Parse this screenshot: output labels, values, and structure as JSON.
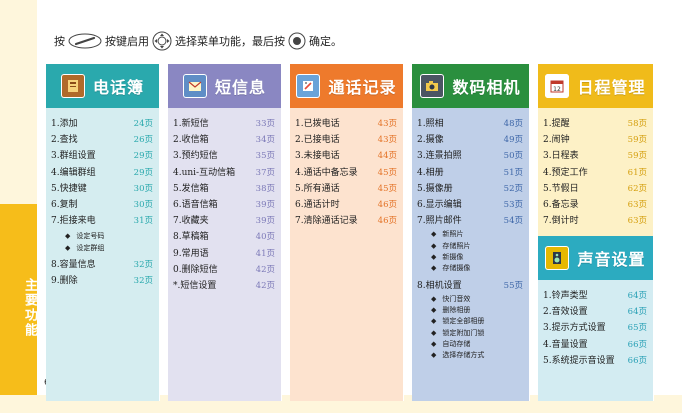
{
  "page": {
    "number": "6",
    "side_label": "主要功能"
  },
  "instruction": {
    "part1": "按",
    "part2": "按键启用",
    "part3": "选择菜单功能，最后按",
    "part4": "确定。"
  },
  "columns": [
    {
      "title": "电话簿",
      "icon": "phonebook-icon",
      "items": [
        {
          "label": "1.添加",
          "page": "24页"
        },
        {
          "label": "2.查找",
          "page": "26页"
        },
        {
          "label": "3.群组设置",
          "page": "29页"
        },
        {
          "label": "4.编辑群组",
          "page": "29页"
        },
        {
          "label": "5.快捷键",
          "page": "30页"
        },
        {
          "label": "6.复制",
          "page": "30页"
        },
        {
          "label": "7.拒接来电",
          "page": "31页",
          "subs": [
            "设定号码",
            "设定群组"
          ]
        },
        {
          "label": "8.容量信息",
          "page": "32页"
        },
        {
          "label": "9.删除",
          "page": "32页"
        }
      ]
    },
    {
      "title": "短信息",
      "icon": "envelope-icon",
      "items": [
        {
          "label": "1.新短信",
          "page": "33页"
        },
        {
          "label": "2.收信箱",
          "page": "34页"
        },
        {
          "label": "3.预约短信",
          "page": "35页"
        },
        {
          "label": "4.uni-互动信箱",
          "page": "37页"
        },
        {
          "label": "5.发信箱",
          "page": "38页"
        },
        {
          "label": "6.语音信箱",
          "page": "39页"
        },
        {
          "label": "7.收藏夹",
          "page": "39页"
        },
        {
          "label": "8.草稿箱",
          "page": "40页"
        },
        {
          "label": "9.常用语",
          "page": "41页"
        },
        {
          "label": "0.删除短信",
          "page": "42页"
        },
        {
          "label": "*.短信设置",
          "page": "42页"
        }
      ]
    },
    {
      "title": "通话记录",
      "icon": "call-log-icon",
      "items": [
        {
          "label": "1.已拨电话",
          "page": "43页"
        },
        {
          "label": "2.已接电话",
          "page": "43页"
        },
        {
          "label": "3.未接电话",
          "page": "44页"
        },
        {
          "label": "4.通话中备忘录",
          "page": "45页"
        },
        {
          "label": "5.所有通话",
          "page": "45页"
        },
        {
          "label": "6.通话计时",
          "page": "46页"
        },
        {
          "label": "7.清除通话记录",
          "page": "46页"
        }
      ]
    },
    {
      "title": "数码相机",
      "icon": "camera-icon",
      "items": [
        {
          "label": "1.照相",
          "page": "48页"
        },
        {
          "label": "2.摄像",
          "page": "49页"
        },
        {
          "label": "3.连景拍照",
          "page": "50页"
        },
        {
          "label": "4.相册",
          "page": "51页"
        },
        {
          "label": "5.摄像册",
          "page": "52页"
        },
        {
          "label": "6.显示编辑",
          "page": "53页"
        },
        {
          "label": "7.照片邮件",
          "page": "54页",
          "subs": [
            "新照片",
            "存储照片",
            "新摄像",
            "存储摄像"
          ]
        },
        {
          "label": "8.相机设置",
          "page": "55页",
          "subs": [
            "快门音效",
            "删除相册",
            "锁定全部相册",
            "锁定附加门锁",
            "自动存储",
            "选择存储方式"
          ]
        }
      ]
    },
    {
      "title": "日程管理",
      "icon": "calendar-icon",
      "items": [
        {
          "label": "1.提醒",
          "page": "58页"
        },
        {
          "label": "2.闹钟",
          "page": "59页"
        },
        {
          "label": "3.日程表",
          "page": "59页"
        },
        {
          "label": "4.预定工作",
          "page": "61页"
        },
        {
          "label": "5.节假日",
          "page": "62页"
        },
        {
          "label": "6.备忘录",
          "page": "63页"
        },
        {
          "label": "7.倒计时",
          "page": "63页"
        }
      ]
    },
    {
      "title": "声音设置",
      "icon": "speaker-icon",
      "items": [
        {
          "label": "1.铃声类型",
          "page": "64页"
        },
        {
          "label": "2.音效设置",
          "page": "64页"
        },
        {
          "label": "3.提示方式设置",
          "page": "65页"
        },
        {
          "label": "4.音量设置",
          "page": "66页"
        },
        {
          "label": "5.系统提示音设置",
          "page": "66页"
        }
      ]
    }
  ]
}
